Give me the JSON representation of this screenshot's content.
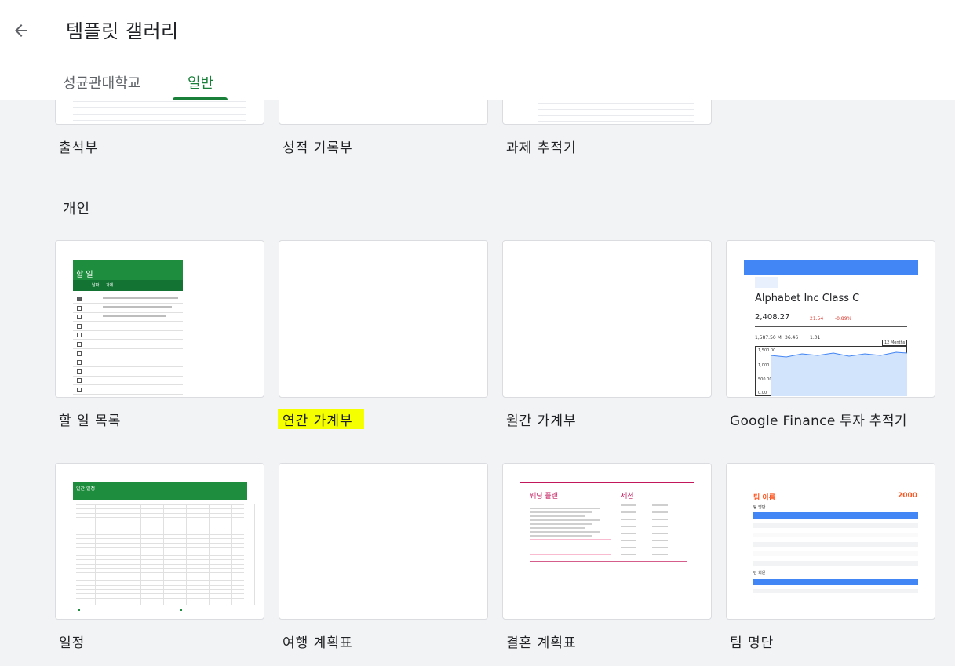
{
  "header": {
    "title": "템플릿 갤러리",
    "tabs": [
      {
        "label": "성균관대학교"
      },
      {
        "label": "일반"
      }
    ]
  },
  "top_row": [
    {
      "label": "출석부"
    },
    {
      "label": "성적 기록부"
    },
    {
      "label": "과제 추적기"
    }
  ],
  "section": {
    "title": "개인"
  },
  "personal": [
    {
      "label": "할 일 목록"
    },
    {
      "label": "연간 가계부"
    },
    {
      "label": "월간 가계부"
    },
    {
      "label": "Google Finance 투자 추적기"
    },
    {
      "label": "일정"
    },
    {
      "label": "여행 계획표"
    },
    {
      "label": "결혼 계획표"
    },
    {
      "label": "팀 명단"
    }
  ],
  "thumbs": {
    "todo": {
      "title": "할 일",
      "hdr1": "날짜",
      "hdr2": "과제"
    },
    "finance": {
      "company": "Alphabet Inc Class C",
      "price": "2,408.27",
      "change": "21.54",
      "pct": "-0.89%",
      "cap": "1,587.50 M",
      "pe": "36.46",
      "vol": "1.01",
      "range": "12 Months",
      "y1": "1,500.00",
      "y2": "1,000.00",
      "y3": "500.00",
      "y4": "0.00"
    },
    "schedule": {
      "title": "일간 일정"
    },
    "wedding": {
      "title": "웨딩 플랜",
      "sub": "세션"
    },
    "team": {
      "title": "팀 이름",
      "year": "2000",
      "h1": "팀 명단",
      "h2": "팀 회원"
    }
  },
  "colors": {
    "accent": "#188038",
    "highlight": "#f5ff00",
    "wedding": "#c2185b",
    "team_red": "#ff5722",
    "team_blue": "#4285f4"
  }
}
